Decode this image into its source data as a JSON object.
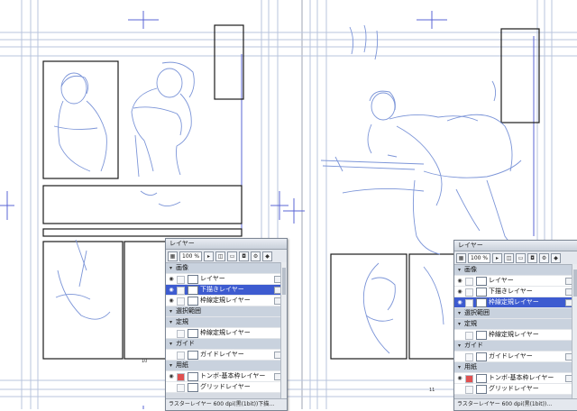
{
  "pages": {
    "left_number": "10",
    "right_number": "11"
  },
  "colors": {
    "guide": "#b9c4de",
    "crosshair": "#5a64d6",
    "sketch": "#7c95d8",
    "frame": "#1a1a1a",
    "panel_selected": "#3d5bd0"
  },
  "panels": [
    {
      "title": "レイヤー",
      "zoom": "100 %",
      "zoom_arrow": "▸",
      "rows": [
        {
          "name": "画像",
          "kind": "group"
        },
        {
          "name": "レイヤー",
          "kind": "layer"
        },
        {
          "name": "下描きレイヤー",
          "kind": "layer",
          "selected": true
        },
        {
          "name": "枠線定規レイヤー",
          "kind": "layer"
        },
        {
          "name": "選択範囲",
          "kind": "group"
        },
        {
          "name": "定規",
          "kind": "group"
        },
        {
          "name": "枠線定規レイヤー",
          "kind": "layer"
        },
        {
          "name": "ガイド",
          "kind": "group"
        },
        {
          "name": "ガイドレイヤー",
          "kind": "layer"
        },
        {
          "name": "用紙",
          "kind": "group"
        },
        {
          "name": "トンボ-基本枠レイヤー",
          "kind": "layer"
        },
        {
          "name": "グリッドレイヤー",
          "kind": "layer"
        }
      ],
      "status": "ラスターレイヤー 600 dpi(黒(1bit))下描…"
    },
    {
      "title": "レイヤー",
      "zoom": "100 %",
      "zoom_arrow": "▸",
      "rows": [
        {
          "name": "画像",
          "kind": "group"
        },
        {
          "name": "レイヤー",
          "kind": "layer"
        },
        {
          "name": "下描きレイヤー",
          "kind": "layer"
        },
        {
          "name": "枠線定規レイヤー",
          "kind": "layer",
          "selected": true
        },
        {
          "name": "選択範囲",
          "kind": "group"
        },
        {
          "name": "定規",
          "kind": "group"
        },
        {
          "name": "枠線定規レイヤー",
          "kind": "layer"
        },
        {
          "name": "ガイド",
          "kind": "group"
        },
        {
          "name": "ガイドレイヤー",
          "kind": "layer"
        },
        {
          "name": "用紙",
          "kind": "group"
        },
        {
          "name": "トンボ-基本枠レイヤー",
          "kind": "layer"
        },
        {
          "name": "グリッドレイヤー",
          "kind": "layer"
        }
      ],
      "status": "ラスターレイヤー 600 dpi(黒(1bit))…"
    }
  ]
}
